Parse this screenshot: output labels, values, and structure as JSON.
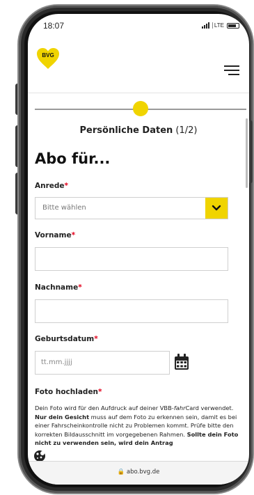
{
  "status": {
    "time": "18:07",
    "network": "LTE"
  },
  "header": {
    "logo_text": "BVG",
    "menu_icon": "hamburger-icon"
  },
  "progress": {
    "value": 0.5
  },
  "form": {
    "step_title": "Persönliche Daten",
    "step_count": "(1/2)",
    "heading": "Abo für...",
    "required_marker": "*",
    "anrede_label": "Anrede",
    "anrede_value": "Bitte wählen",
    "vorname_label": "Vorname",
    "nachname_label": "Nachname",
    "geburtsdatum_label": "Geburtsdatum",
    "geburtsdatum_placeholder": "tt.mm.jjjj",
    "foto_label": "Foto hochladen"
  },
  "foto_text": {
    "p1": "Dein Foto wird für den Aufdruck auf deiner VBB-",
    "p1_italic": "fahr",
    "p1b": "Card verwendet. ",
    "p2_bold": "Nur dein Gesicht",
    "p3": " muss auf dem Foto zu erkennen sein, damit es bei einer Fahrscheinkontrolle nicht zu Problemen kommt. Prüfe bitte den korrekten Bildausschnitt im vorgegebenen Rahmen. ",
    "p4_bold": "Sollte dein Foto nicht zu verwenden sein, wird dein Antrag"
  },
  "browser": {
    "url": "abo.bvg.de"
  },
  "colors": {
    "accent": "#f0d400",
    "required": "#e3001b"
  }
}
